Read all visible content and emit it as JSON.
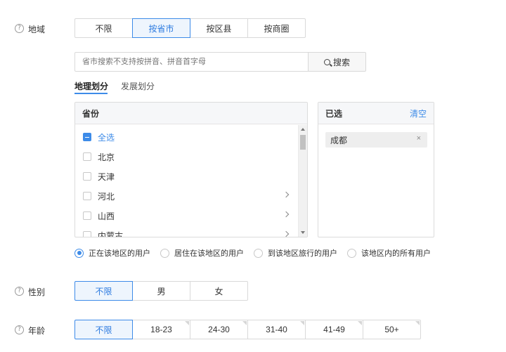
{
  "region": {
    "label": "地域",
    "options": [
      "不限",
      "按省市",
      "按区县",
      "按商圈"
    ],
    "selected_index": 1,
    "search": {
      "placeholder": "省市搜索不支持按拼音、拼音首字母",
      "button_label": "搜索"
    },
    "subtabs": [
      "地理划分",
      "发展划分"
    ],
    "active_subtab": 0,
    "province_panel": {
      "header": "省份",
      "items": [
        {
          "label": "全选",
          "state": "indeterminate",
          "has_children": false
        },
        {
          "label": "北京",
          "state": "unchecked",
          "has_children": false
        },
        {
          "label": "天津",
          "state": "unchecked",
          "has_children": false
        },
        {
          "label": "河北",
          "state": "unchecked",
          "has_children": true
        },
        {
          "label": "山西",
          "state": "unchecked",
          "has_children": true
        },
        {
          "label": "内蒙古",
          "state": "unchecked",
          "has_children": true
        }
      ]
    },
    "selected_panel": {
      "header": "已选",
      "clear_label": "清空",
      "tags": [
        {
          "label": "成都",
          "remove_icon": "×"
        }
      ]
    },
    "user_scope": {
      "options": [
        "正在该地区的用户",
        "居住在该地区的用户",
        "到该地区旅行的用户",
        "该地区内的所有用户"
      ],
      "selected_index": 0
    }
  },
  "gender": {
    "label": "性别",
    "options": [
      "不限",
      "男",
      "女"
    ],
    "selected_index": 0
  },
  "age": {
    "label": "年龄",
    "options": [
      "不限",
      "18-23",
      "24-30",
      "31-40",
      "41-49",
      "50+"
    ],
    "selected_index": 0
  },
  "icons": {
    "help": "help-circle-icon",
    "search": "search-icon",
    "chevron": "chevron-right-icon",
    "close": "close-icon"
  },
  "colors": {
    "accent": "#3d8be8",
    "active_bg": "#eef5fd",
    "border": "#d9d9d9"
  },
  "help_glyph": "?"
}
